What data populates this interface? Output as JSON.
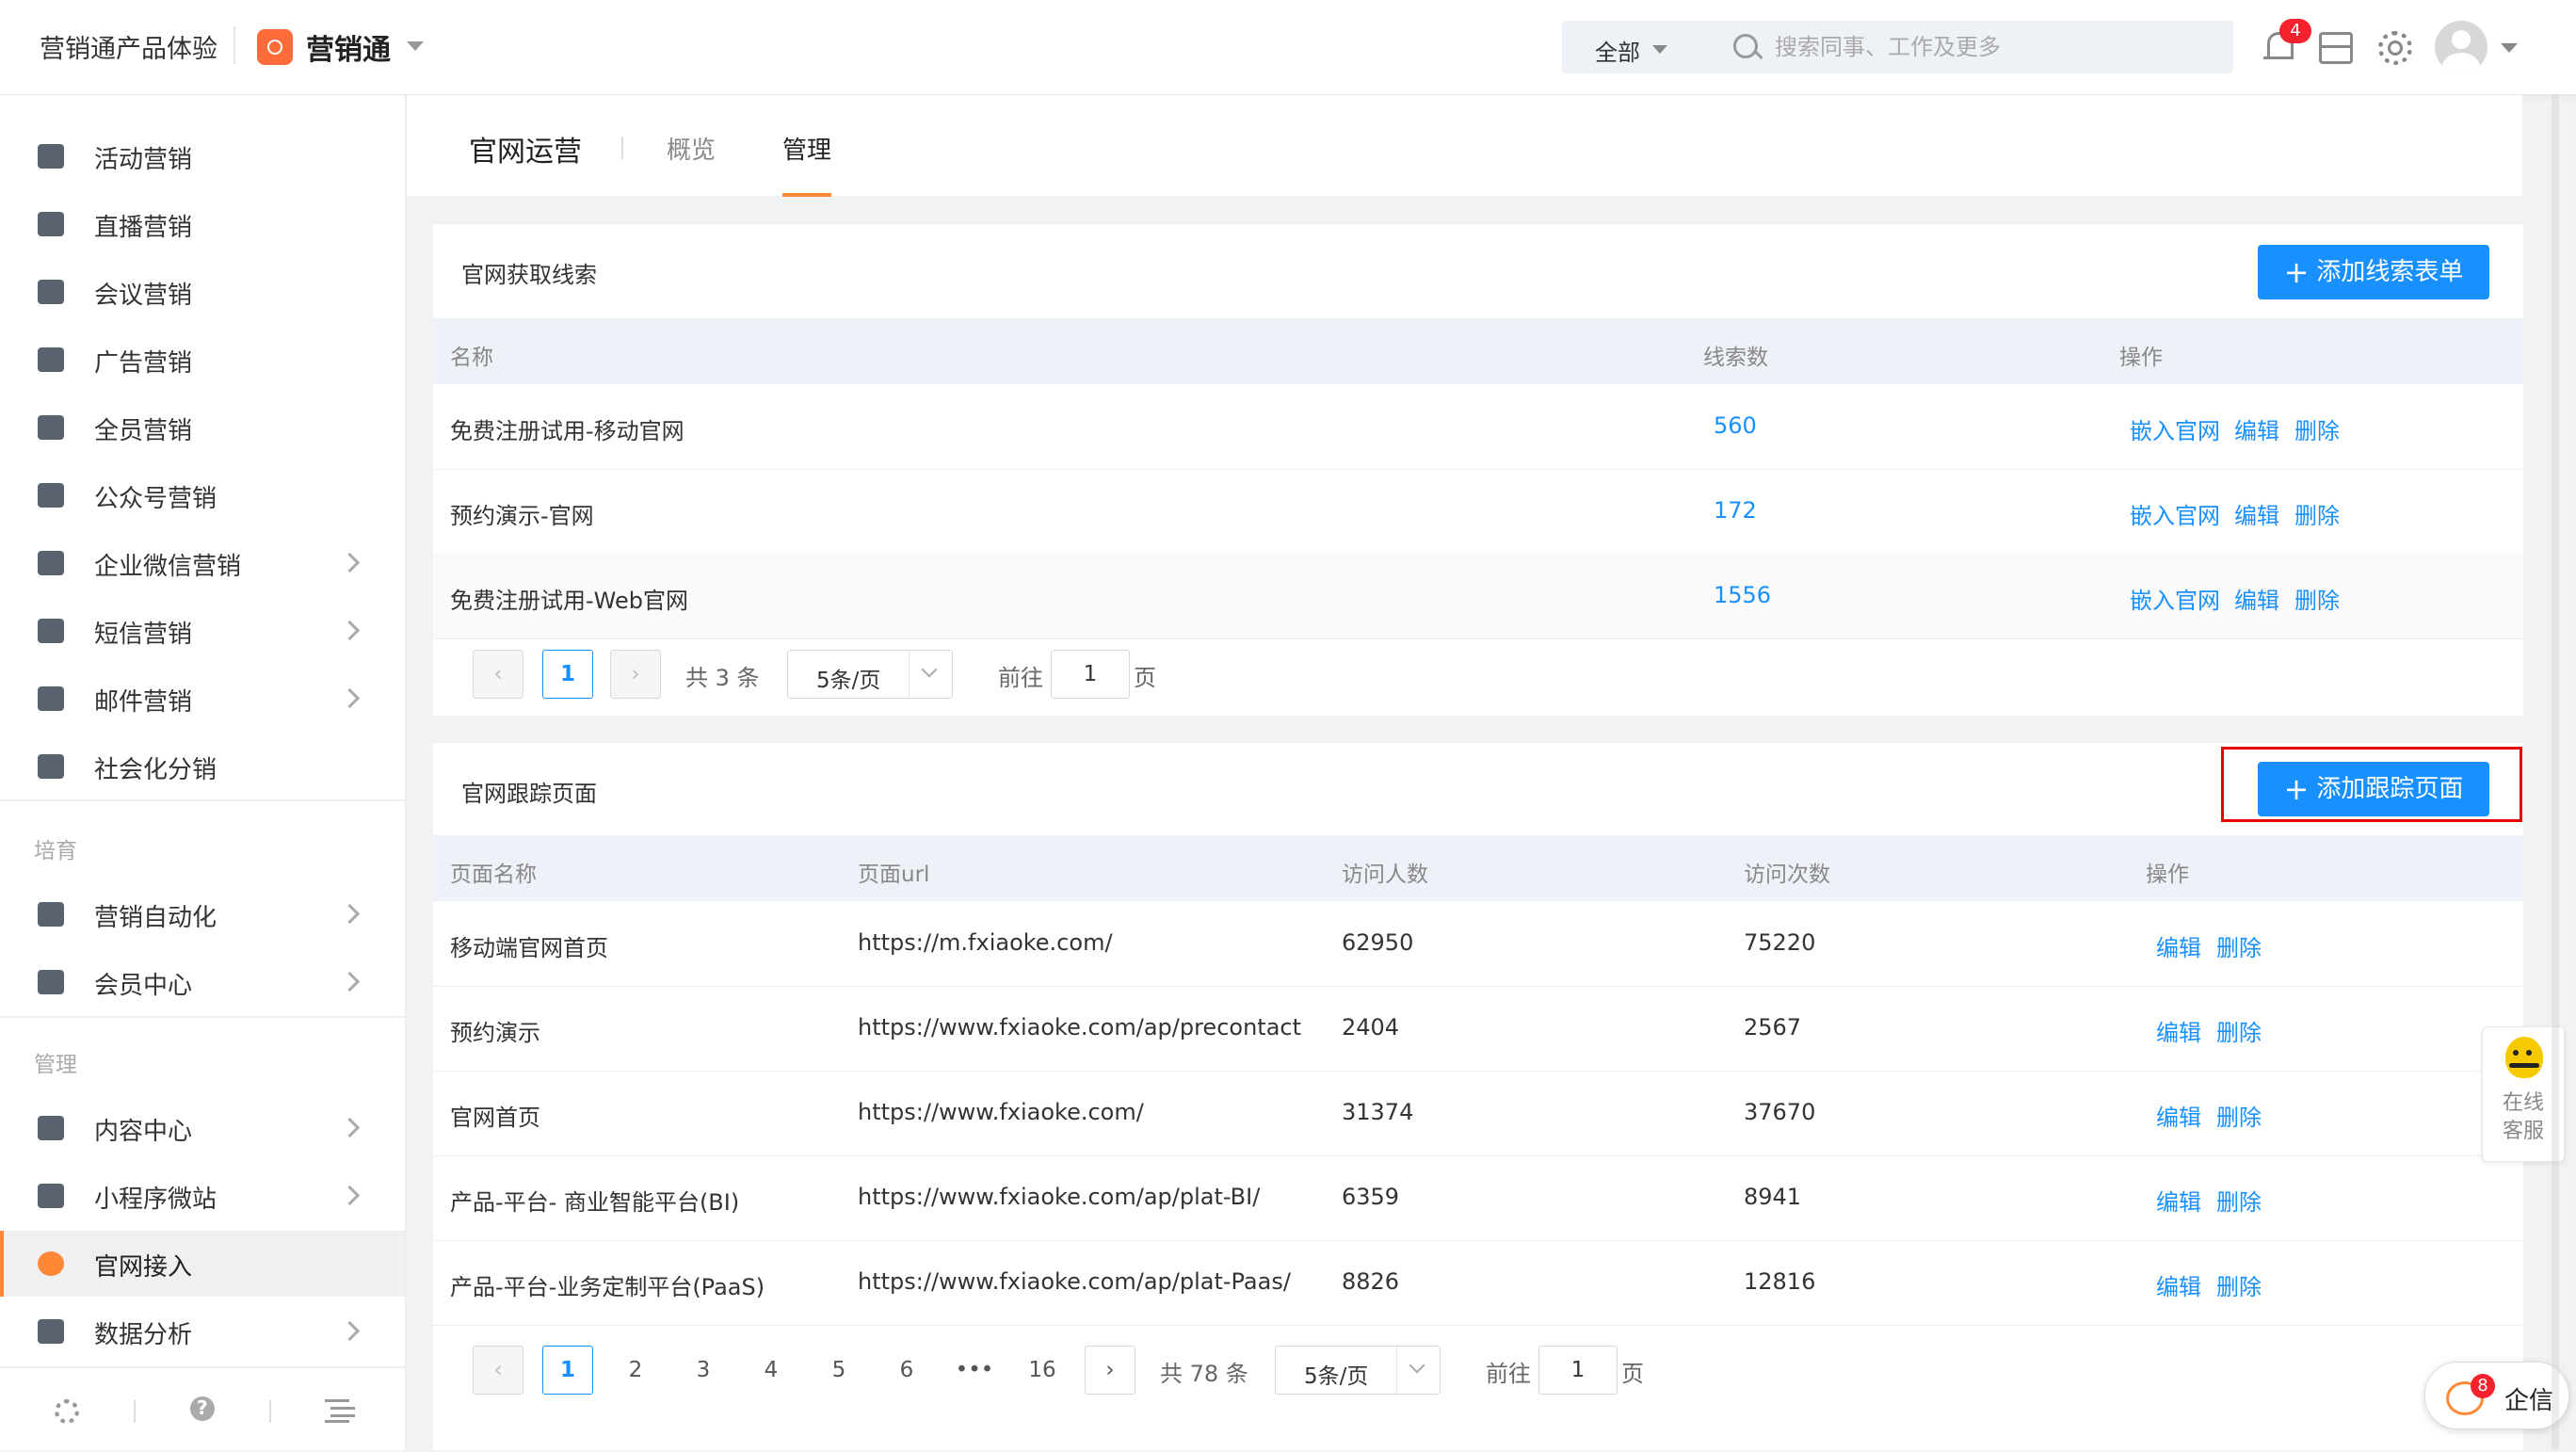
{
  "header": {
    "workspace": "营销通产品体验",
    "app_name": "营销通",
    "search_scope": "全部",
    "search_placeholder": "搜索同事、工作及更多",
    "notification_count": "4"
  },
  "sidebar": {
    "items": [
      {
        "label": "活动营销",
        "icon": "activity-icon",
        "chevron": false
      },
      {
        "label": "直播营销",
        "icon": "live-icon",
        "chevron": false
      },
      {
        "label": "会议营销",
        "icon": "meeting-icon",
        "chevron": false
      },
      {
        "label": "广告营销",
        "icon": "ad-icon",
        "chevron": false
      },
      {
        "label": "全员营销",
        "icon": "team-icon",
        "chevron": false
      },
      {
        "label": "公众号营销",
        "icon": "wechat-icon",
        "chevron": false
      },
      {
        "label": "企业微信营销",
        "icon": "wecom-icon",
        "chevron": true
      },
      {
        "label": "短信营销",
        "icon": "sms-icon",
        "chevron": true
      },
      {
        "label": "邮件营销",
        "icon": "mail-icon",
        "chevron": true
      },
      {
        "label": "社会化分销",
        "icon": "distribution-icon",
        "chevron": false
      }
    ],
    "group_cultivate": "培育",
    "cultivate_items": [
      {
        "label": "营销自动化",
        "icon": "automation-icon",
        "chevron": true
      },
      {
        "label": "会员中心",
        "icon": "vip-icon",
        "chevron": true
      }
    ],
    "group_manage": "管理",
    "manage_items": [
      {
        "label": "内容中心",
        "icon": "layers-icon",
        "chevron": true
      },
      {
        "label": "小程序微站",
        "icon": "miniapp-icon",
        "chevron": true
      },
      {
        "label": "官网接入",
        "icon": "website-icon",
        "chevron": false,
        "active": true
      },
      {
        "label": "数据分析",
        "icon": "chart-icon",
        "chevron": true
      }
    ]
  },
  "page": {
    "title": "官网运营",
    "tabs": [
      "概览",
      "管理"
    ],
    "active_tab": "管理"
  },
  "leads": {
    "title": "官网获取线索",
    "add_button": "添加线索表单",
    "columns": [
      "名称",
      "线索数",
      "操作"
    ],
    "rows": [
      {
        "name": "免费注册试用-移动官网",
        "count": "560"
      },
      {
        "name": "预约演示-官网",
        "count": "172"
      },
      {
        "name": "免费注册试用-Web官网",
        "count": "1556"
      }
    ],
    "actions": [
      "嵌入官网",
      "编辑",
      "删除"
    ],
    "pager": {
      "current": "1",
      "total": "共 3 条",
      "page_size": "5条/页",
      "goto_label": "前往",
      "goto_value": "1",
      "page_unit": "页"
    }
  },
  "tracking": {
    "title": "官网跟踪页面",
    "add_button": "添加跟踪页面",
    "columns": [
      "页面名称",
      "页面url",
      "访问人数",
      "访问次数",
      "操作"
    ],
    "rows": [
      {
        "name": "移动端官网首页",
        "url": "https://m.fxiaoke.com/",
        "visitors": "62950",
        "visits": "75220"
      },
      {
        "name": "预约演示",
        "url": "https://www.fxiaoke.com/ap/precontact",
        "visitors": "2404",
        "visits": "2567"
      },
      {
        "name": "官网首页",
        "url": "https://www.fxiaoke.com/",
        "visitors": "31374",
        "visits": "37670"
      },
      {
        "name": "产品-平台- 商业智能平台(BI)",
        "url": "https://www.fxiaoke.com/ap/plat-BI/",
        "visitors": "6359",
        "visits": "8941"
      },
      {
        "name": "产品-平台-业务定制平台(PaaS)",
        "url": "https://www.fxiaoke.com/ap/plat-Paas/",
        "visitors": "8826",
        "visits": "12816"
      }
    ],
    "actions": [
      "编辑",
      "删除"
    ],
    "pager": {
      "pages": [
        "1",
        "2",
        "3",
        "4",
        "5",
        "6",
        "•••",
        "16"
      ],
      "current": "1",
      "total": "共 78 条",
      "page_size": "5条/页",
      "goto_label": "前往",
      "goto_value": "1",
      "page_unit": "页"
    }
  },
  "float": {
    "service_line1": "在线",
    "service_line2": "客服",
    "qixin_label": "企信",
    "qixin_badge": "8"
  },
  "colors": {
    "accent": "#ff8837",
    "primary": "#1890ff",
    "highlight": "#e60000"
  }
}
